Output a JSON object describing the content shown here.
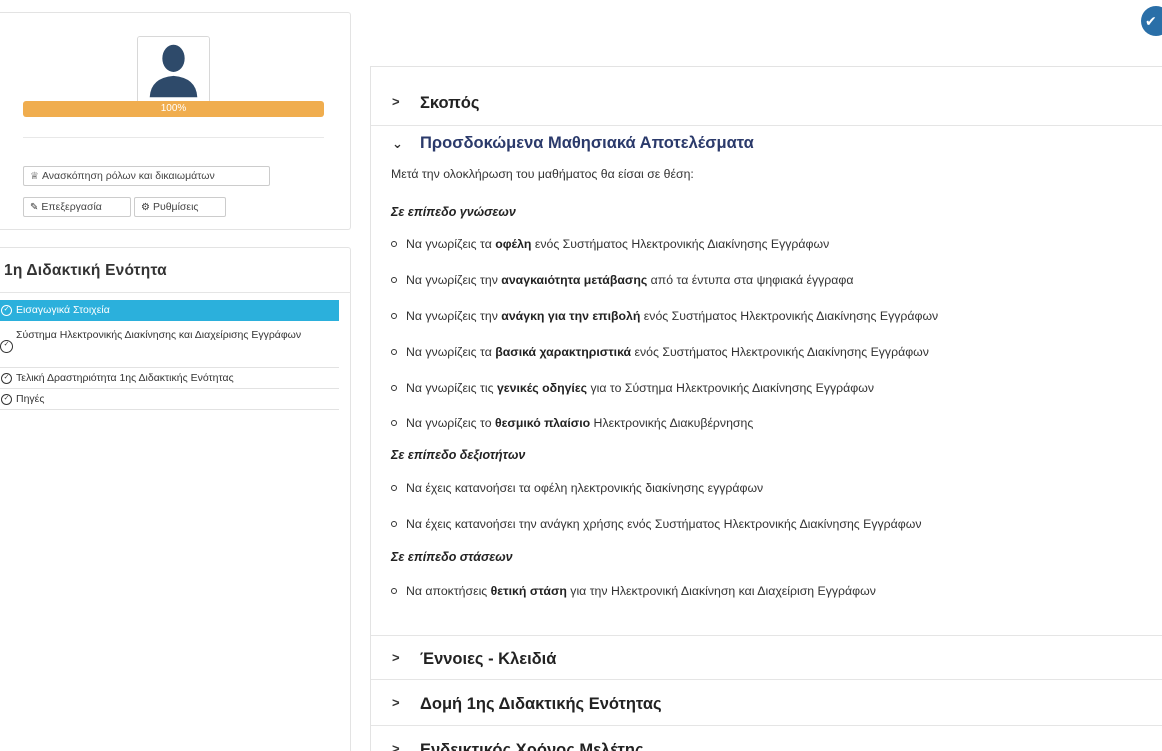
{
  "profile": {
    "avatar_icon": "user-silhouette-icon",
    "progress_value": 100,
    "progress_label": "100%",
    "progress_color": "#f0ad4e",
    "buttons": {
      "roles_label": "Ανασκόπηση ρόλων και δικαιωμάτων",
      "roles_icon": "user-shield-icon",
      "edit_label": "Επεξεργασία",
      "edit_icon": "pencil-icon",
      "settings_label": "Ρυθμίσεις",
      "settings_icon": "gear-icon"
    }
  },
  "unit": {
    "title": "1η Διδακτική Ενότητα",
    "active_color": "#2bb0dc",
    "items": [
      {
        "label": "Εισαγωγικά Στοιχεία",
        "active": true
      },
      {
        "label": "Σύστημα Ηλεκτρονικής Διακίνησης και Διαχείρισης Εγγράφων",
        "active": false
      },
      {
        "label": "Τελική Δραστηριότητα 1ης Διδακτικής Ενότητας",
        "active": false
      },
      {
        "label": "Πηγές",
        "active": false
      }
    ]
  },
  "content": {
    "sections": {
      "scope": "Σκοπός",
      "outcomes": "Προσδοκώμενα Μαθησιακά Αποτελέσματα",
      "concepts": "Έννοιες - Κλειδιά",
      "structure": "Δομή 1ης Διδακτικής Ενότητας",
      "study_time": "Ενδεικτικός Χρόνος Μελέτης"
    },
    "intro": "Μετά την ολοκλήρωση του μαθήματος θα είσαι σε θέση:",
    "categories": {
      "knowledge": "Σε επίπεδο γνώσεων",
      "skills": "Σε επίπεδο δεξιοτήτων",
      "attitudes": "Σε επίπεδο στάσεων"
    },
    "knowledge_items": [
      {
        "pre": "Να γνωρίζεις τα ",
        "bold": "οφέλη",
        "post": " ενός Συστήματος Ηλεκτρονικής Διακίνησης Εγγράφων"
      },
      {
        "pre": "Να γνωρίζεις την ",
        "bold": "αναγκαιότητα μετάβασης",
        "post": " από τα έντυπα στα ψηφιακά έγγραφα"
      },
      {
        "pre": "Να γνωρίζεις την ",
        "bold": "ανάγκη για την επιβολή",
        "post": " ενός Συστήματος Ηλεκτρονικής Διακίνησης Εγγράφων"
      },
      {
        "pre": "Να γνωρίζεις τα ",
        "bold": "βασικά χαρακτηριστικά",
        "post": " ενός Συστήματος Ηλεκτρονικής Διακίνησης Εγγράφων"
      },
      {
        "pre": "Να γνωρίζεις τις ",
        "bold": "γενικές οδηγίες",
        "post": " για το Σύστημα Ηλεκτρονικής Διακίνησης Εγγράφων"
      },
      {
        "pre": "Να γνωρίζεις το ",
        "bold": "θεσμικό πλαίσιο",
        "post": " Ηλεκτρονικής Διακυβέρνησης"
      }
    ],
    "skills_items": [
      {
        "pre": "Να έχεις κατανοήσει τα οφέλη ηλεκτρονικής διακίνησης εγγράφων",
        "bold": "",
        "post": ""
      },
      {
        "pre": "Να έχεις κατανοήσει την ανάγκη χρήσης ενός Συστήματος Ηλεκτρονικής Διακίνησης Εγγράφων",
        "bold": "",
        "post": ""
      }
    ],
    "attitudes_items": [
      {
        "pre": "Να αποκτήσεις ",
        "bold": "θετική στάση",
        "post": " για την Ηλεκτρονική Διακίνηση και Διαχείριση Εγγράφων"
      }
    ],
    "title_color": "#2b3a6b"
  },
  "corner_badge_icon": "check-badge-icon",
  "corner_badge_color": "#2a6fa8"
}
